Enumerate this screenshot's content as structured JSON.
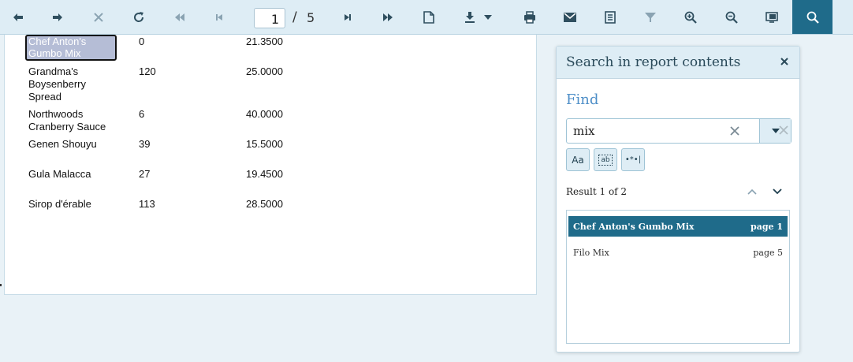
{
  "toolbar": {
    "buttons": [
      {
        "name": "back-icon",
        "title": "Navigate back"
      },
      {
        "name": "forward-icon",
        "title": "Navigate forward"
      },
      {
        "name": "stop-icon",
        "title": "Stop rendering"
      },
      {
        "name": "refresh-icon",
        "title": "Refresh"
      },
      {
        "name": "first-page-icon",
        "title": "First page"
      },
      {
        "name": "previous-page-icon",
        "title": "Previous page"
      },
      {
        "name": "next-page-icon",
        "title": "Next page"
      },
      {
        "name": "last-page-icon",
        "title": "Last page"
      },
      {
        "name": "print-layout-icon",
        "title": "Toggle print preview"
      },
      {
        "name": "export-icon",
        "title": "Export"
      },
      {
        "name": "print-icon",
        "title": "Print"
      },
      {
        "name": "send-mail-icon",
        "title": "Send mail"
      },
      {
        "name": "document-map-icon",
        "title": "Document map"
      },
      {
        "name": "filter-icon",
        "title": "Parameters"
      },
      {
        "name": "zoom-in-icon",
        "title": "Zoom in"
      },
      {
        "name": "zoom-out-icon",
        "title": "Zoom out"
      },
      {
        "name": "view-mode-icon",
        "title": "Toggle zoom mode"
      },
      {
        "name": "search-icon",
        "title": "Search"
      }
    ],
    "current_page": "1",
    "page_separator": "/",
    "total_pages": "5"
  },
  "report": {
    "rows": [
      {
        "name": "Chef Anton's Gumbo Mix",
        "qty": "0",
        "price": "21.3500",
        "highlighted": true
      },
      {
        "name": "Grandma's Boysenberry Spread",
        "qty": "120",
        "price": "25.0000"
      },
      {
        "name": "Northwoods Cranberry Sauce",
        "qty": "6",
        "price": "40.0000"
      },
      {
        "name": "Genen Shouyu",
        "qty": "39",
        "price": "15.5000"
      },
      {
        "name": "Gula Malacca",
        "qty": "27",
        "price": "19.4500"
      },
      {
        "name": "Sirop d'érable",
        "qty": "113",
        "price": "28.5000"
      }
    ]
  },
  "search_panel": {
    "title": "Search in report contents",
    "find_label": "Find",
    "search_value": "mix",
    "options": [
      {
        "label": "Aa",
        "name": "match-case-button"
      },
      {
        "label": "ab",
        "name": "match-whole-word-button"
      },
      {
        "label": "•*•|",
        "name": "use-regex-button"
      }
    ],
    "result_count": "Result 1 of 2",
    "results": [
      {
        "text": "Chef Anton's Gumbo Mix",
        "page": "page 1",
        "selected": true
      },
      {
        "text": "Filo Mix",
        "page": "page 5",
        "selected": false
      }
    ]
  },
  "colors": {
    "toolbar_bg": "#deedf5",
    "accent": "#1f6b8a",
    "find_label": "#4f8fc8",
    "highlight_bg": "#b5bdd6"
  }
}
